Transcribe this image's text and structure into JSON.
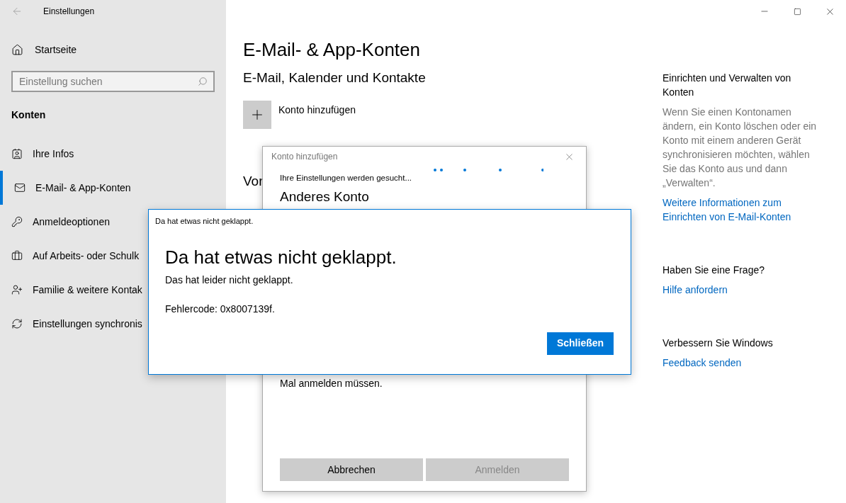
{
  "window": {
    "title": "Einstellungen"
  },
  "sidebar": {
    "home": "Startseite",
    "search": {
      "placeholder": "Einstellung suchen"
    },
    "section": "Konten",
    "items": [
      {
        "label": "Ihre Infos",
        "selected": false
      },
      {
        "label": "E-Mail- & App-Konten",
        "selected": true
      },
      {
        "label": "Anmeldeoptionen",
        "selected": false
      },
      {
        "label": "Auf Arbeits- oder Schulk",
        "selected": false
      },
      {
        "label": "Familie & weitere Kontak",
        "selected": false
      },
      {
        "label": "Einstellungen synchronis",
        "selected": false
      }
    ]
  },
  "main": {
    "title": "E-Mail- & App-Konten",
    "subtitle": "E-Mail, Kalender und Kontakte",
    "add_account": "Konto hinzufügen",
    "section_2": "Vor"
  },
  "aside": [
    {
      "heading": "Einrichten und Verwalten von Konten",
      "text": "Wenn Sie einen Kontonamen ändern, ein Konto löschen oder ein Konto mit einem anderen Gerät synchronisieren möchten, wählen Sie das Konto aus und dann „Verwalten“.",
      "link": "Weitere Informationen zum Einrichten von E-Mail-Konten"
    },
    {
      "heading": "Haben Sie eine Frage?",
      "link": "Hilfe anfordern"
    },
    {
      "heading": "Verbessern Sie Windows",
      "link": "Feedback senden"
    }
  ],
  "add_dialog": {
    "title": "Konto hinzufügen",
    "status": "Ihre Einstellungen werden gesucht...",
    "heading": "Anderes Konto",
    "text": "Mal anmelden müssen.",
    "buttons": [
      {
        "label": "Abbrechen",
        "disabled": false
      },
      {
        "label": "Anmelden",
        "disabled": true
      }
    ]
  },
  "error_dialog": {
    "title": "Da hat etwas nicht geklappt.",
    "heading": "Da hat etwas nicht geklappt.",
    "message": "Das hat leider nicht geklappt.",
    "error_code": "Fehlercode: 0x8007139f.",
    "button": "Schließen"
  }
}
